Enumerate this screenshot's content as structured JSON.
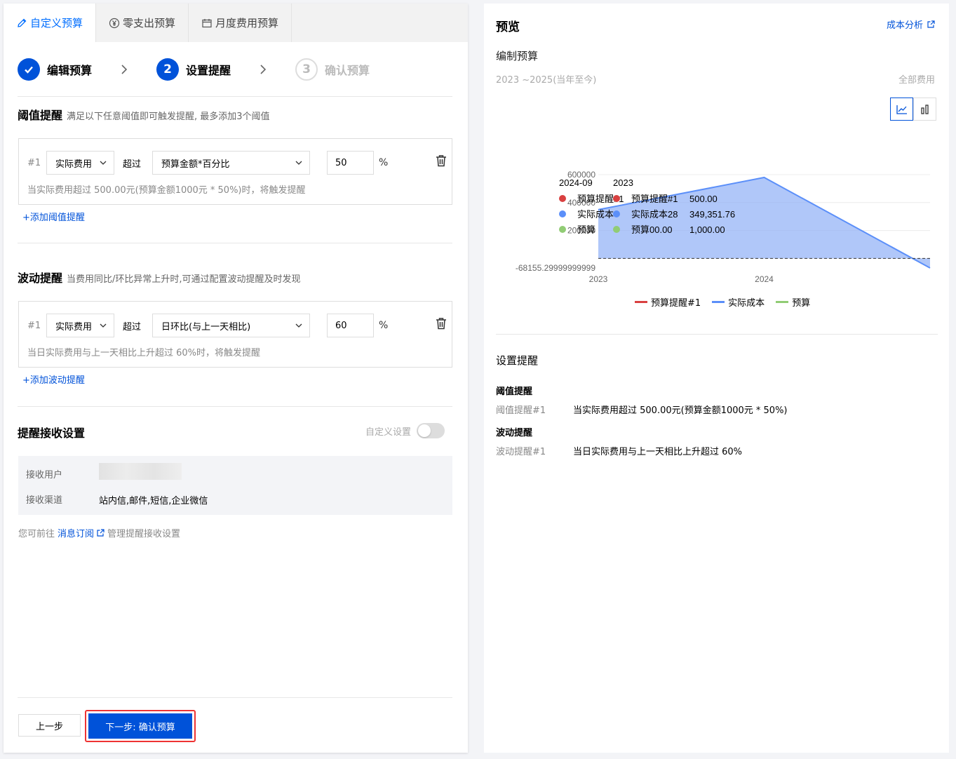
{
  "tabs": [
    {
      "label": "自定义预算",
      "icon": "pencil-icon",
      "active": true
    },
    {
      "label": "零支出预算",
      "icon": "yen-circle-icon",
      "active": false
    },
    {
      "label": "月度费用预算",
      "icon": "calendar-icon",
      "active": false
    }
  ],
  "stepper": {
    "steps": [
      {
        "number": "",
        "label": "编辑预算",
        "state": "done"
      },
      {
        "number": "2",
        "label": "设置提醒",
        "state": "current"
      },
      {
        "number": "3",
        "label": "确认预算",
        "state": "todo"
      }
    ]
  },
  "threshold": {
    "title": "阈值提醒",
    "desc": "满足以下任意阈值即可触发提醒, 最多添加3个阈值",
    "rule": {
      "index": "#1",
      "metric": "实际费用",
      "operator": "超过",
      "basis": "预算金额*百分比",
      "value": "50",
      "unit": "%",
      "hint": "当实际费用超过 500.00元(预算金额1000元 * 50%)时，将触发提醒"
    },
    "add_label": "+添加阈值提醒"
  },
  "fluctuation": {
    "title": "波动提醒",
    "desc": "当费用同比/环比异常上升时,可通过配置波动提醒及时发现",
    "rule": {
      "index": "#1",
      "metric": "实际费用",
      "operator": "超过",
      "basis": "日环比(与上一天相比)",
      "value": "60",
      "unit": "%",
      "hint": "当日实际费用与上一天相比上升超过 60%时，将触发提醒"
    },
    "add_label": "+添加波动提醒"
  },
  "receive": {
    "title": "提醒接收设置",
    "toggle_label": "自定义设置",
    "toggle_on": false,
    "user_label": "接收用户",
    "channel_label": "接收渠道",
    "channel_value": "站内信,邮件,短信,企业微信",
    "note_prefix": "您可前往",
    "note_link": "消息订阅",
    "note_suffix": "管理提醒接收设置"
  },
  "buttons": {
    "prev": "上一步",
    "next": "下一步: 确认预算"
  },
  "preview": {
    "title": "预览",
    "cost_link": "成本分析",
    "subtitle": "编制预算",
    "range": "2023 ~2025(当年至今)",
    "scope": "全部费用",
    "tooltip": {
      "col1_header": "2024-09",
      "col2_header": "2023",
      "rows": [
        {
          "name1": "预算提醒#1",
          "name2": "预算提醒#1",
          "value": "500.00",
          "color": "#d94040"
        },
        {
          "name1": "实际成本",
          "name2": "实际成本28",
          "value": "349,351.76",
          "color": "#5b8ff9"
        },
        {
          "name1": "预算",
          "name2": "预算00.00",
          "value": "1,000.00",
          "color": "#91cc75"
        }
      ]
    },
    "settings_title": "设置提醒",
    "threshold_heading": "阈值提醒",
    "threshold_key": "阈值提醒#1",
    "threshold_value": "当实际费用超过 500.00元(预算金额1000元 * 50%)",
    "fluct_heading": "波动提醒",
    "fluct_key": "波动提醒#1",
    "fluct_value": "当日实际费用与上一天相比上升超过 60%"
  },
  "chart_data": {
    "type": "area",
    "x": [
      "2023",
      "2024",
      "2025"
    ],
    "x_tick_labels": [
      "2023",
      "2024"
    ],
    "y_tick_labels": [
      "600000",
      "400000",
      "200000",
      "-68155.29999999999"
    ],
    "ylim": [
      -68155.3,
      600000
    ],
    "series": [
      {
        "name": "预算提醒#1",
        "values": [
          500,
          500,
          500
        ],
        "color": "#d94040"
      },
      {
        "name": "实际成本",
        "values": [
          349351.76,
          580000,
          -68155.3
        ],
        "color": "#5b8ff9"
      },
      {
        "name": "预算",
        "values": [
          1000,
          1000,
          1000
        ],
        "color": "#91cc75"
      }
    ],
    "legend_position": "bottom",
    "grid": true
  }
}
